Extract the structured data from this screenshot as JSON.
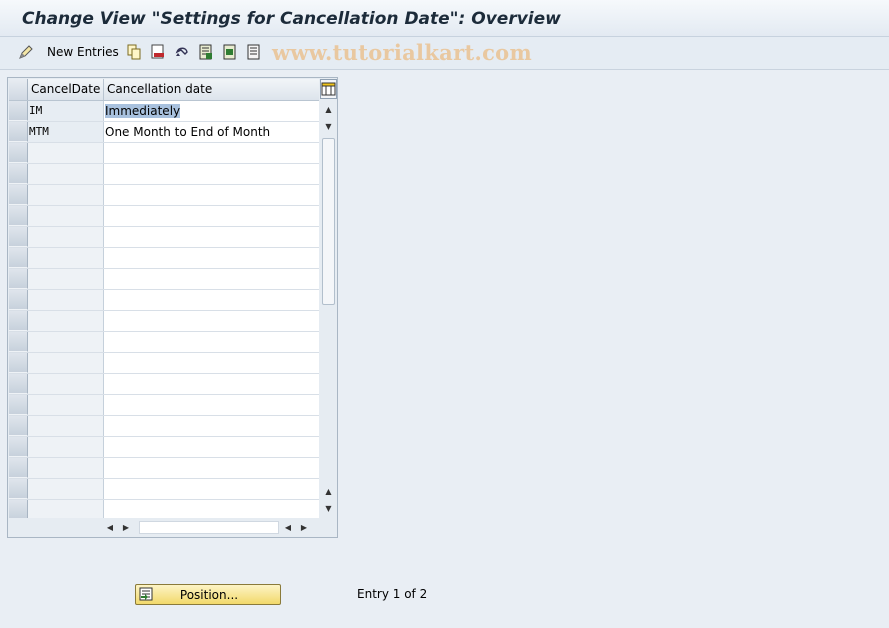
{
  "window": {
    "title": "Change View \"Settings for Cancellation Date\": Overview"
  },
  "toolbar": {
    "items": [
      {
        "name": "display-change-icon"
      },
      {
        "name": "new-entries",
        "label": "New Entries"
      },
      {
        "name": "copy-icon"
      },
      {
        "name": "delete-icon"
      },
      {
        "name": "undo-icon"
      },
      {
        "name": "select-all-icon"
      },
      {
        "name": "select-block-icon"
      },
      {
        "name": "deselect-all-icon"
      }
    ],
    "watermark": "www.tutorialkart.com"
  },
  "table": {
    "columns": [
      "CancelDate",
      "Cancellation date"
    ],
    "rows": [
      {
        "key": "IM",
        "desc": "Immediately",
        "selected_desc": true
      },
      {
        "key": "MTM",
        "desc": "One Month to End of Month"
      }
    ],
    "empty_rows": 18
  },
  "footer": {
    "position_button": "Position...",
    "entry_info": "Entry 1 of 2"
  },
  "colors": {
    "title_text": "#1c2b3a",
    "button_yellow": "#f2d96b",
    "selection": "#a8c1de",
    "watermark": "#e9c8a0"
  }
}
